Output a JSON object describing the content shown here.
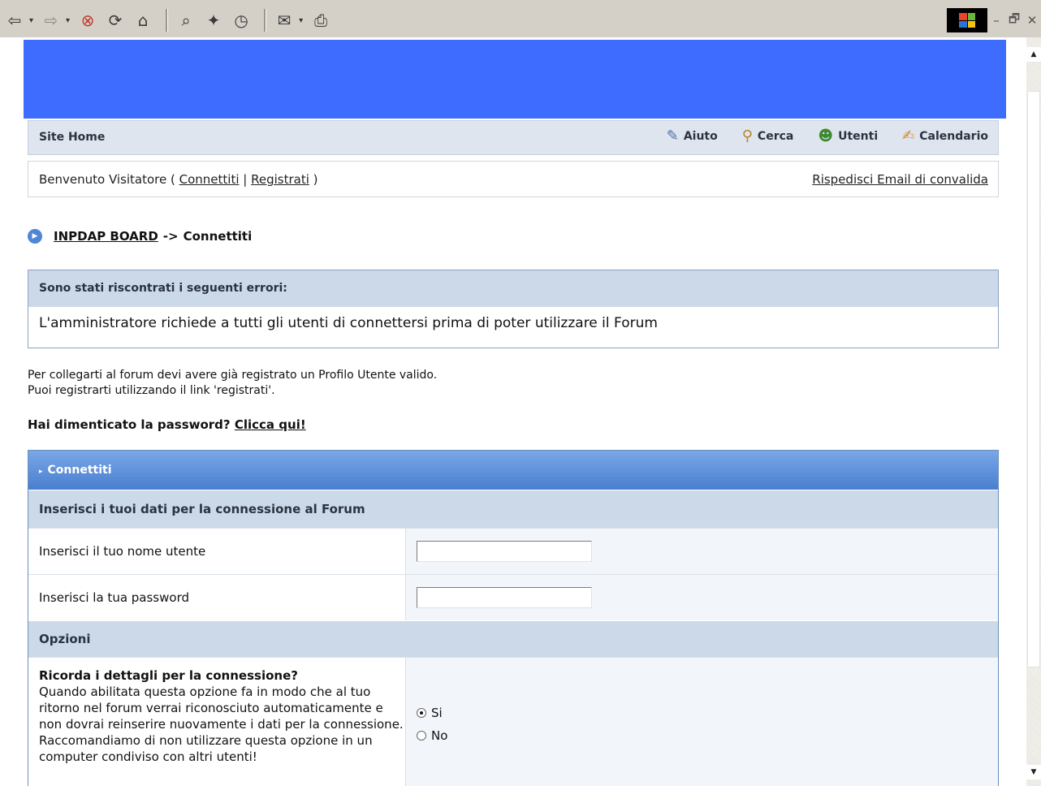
{
  "browser": {
    "toolbar_icons": [
      "back-arrow-icon",
      "forward-arrow-icon",
      "stop-icon",
      "refresh-icon",
      "home-icon",
      "search-icon",
      "favorites-icon",
      "history-icon",
      "mail-icon",
      "print-icon"
    ],
    "window_controls": {
      "minimize": "–",
      "restore": "🗗",
      "close": "✕"
    }
  },
  "navbar": {
    "site_home": "Site Home",
    "links": [
      {
        "label": "Aiuto",
        "icon": "help-icon"
      },
      {
        "label": "Cerca",
        "icon": "search-icon"
      },
      {
        "label": "Utenti",
        "icon": "users-icon"
      },
      {
        "label": "Calendario",
        "icon": "calendar-icon"
      }
    ]
  },
  "welcome": {
    "text_prefix": "Benvenuto Visitatore ( ",
    "login_link": "Connettiti",
    "separator": " | ",
    "register_link": "Registrati",
    "text_suffix": " )",
    "resend_link": "Rispedisci Email di convalida"
  },
  "breadcrumb": {
    "home": "INPDAP BOARD",
    "separator": "->",
    "current": "Connettiti"
  },
  "error": {
    "title": "Sono stati riscontrati i seguenti errori:",
    "message": "L'amministratore richiede a tutti gli utenti di connettersi prima di poter utilizzare il Forum"
  },
  "info": {
    "line1": "Per collegarti al forum devi avere già registrato un Profilo Utente valido.",
    "line2": "Puoi registrarti utilizzando il link 'registrati'."
  },
  "forgot": {
    "question": "Hai dimenticato la password? ",
    "link": "Clicca qui!"
  },
  "login_form": {
    "title": "Connettiti",
    "subtitle": "Inserisci i tuoi dati per la connessione al Forum",
    "username_label": "Inserisci il tuo nome utente",
    "username_value": "",
    "password_label": "Inserisci la tua password",
    "password_value": "",
    "options_title": "Opzioni",
    "remember_title": "Ricorda i dettagli per la connessione?",
    "remember_desc": "Quando abilitata questa opzione fa in modo che al tuo ritorno nel forum verrai riconosciuto automaticamente e non dovrai reinserire nuovamente i dati per la connessione. Raccomandiamo di non utilizzare questa opzione in un computer condiviso con altri utenti!",
    "radio_yes": "Si",
    "radio_no": "No",
    "selected": "Si"
  },
  "colors": {
    "banner": "#3d6cff",
    "form_header": "#4a7fd0",
    "section_header": "#ccd9e8"
  }
}
